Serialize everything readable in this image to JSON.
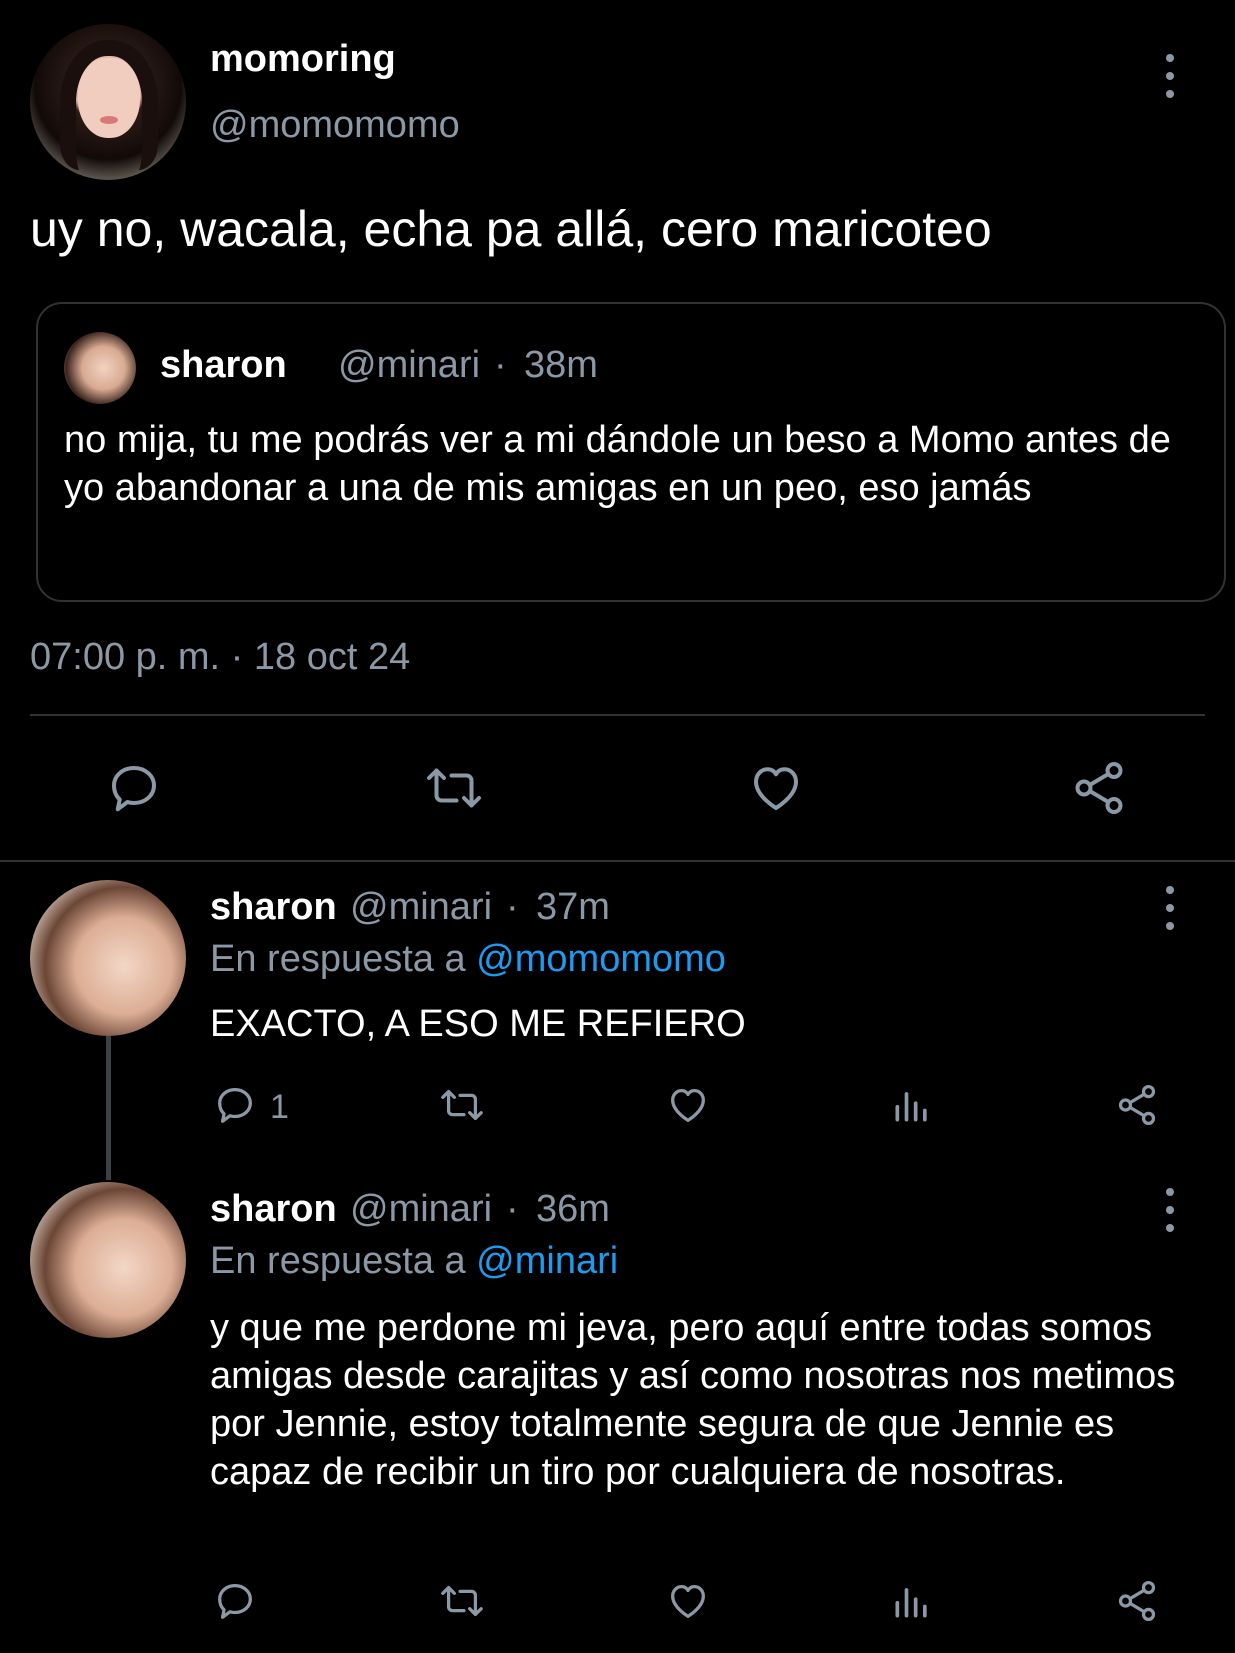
{
  "main_tweet": {
    "author_name": "momoring",
    "author_handle": "@momomomo",
    "text": "uy no, wacala, echa pa allá, cero maricoteo",
    "timestamp": "07:00 p. m. · 18 oct 24",
    "quoted": {
      "author_name": "sharon",
      "author_handle": "@minari",
      "time_sep": "·",
      "time": "38m",
      "text": "no mija, tu me podrás ver a mi dándole un beso a Momo antes de yo abandonar a una de mis amigas en un peo, eso jamás"
    },
    "actions": [
      "reply-icon",
      "retweet-icon",
      "like-icon",
      "share-icon"
    ]
  },
  "replies": [
    {
      "author_name": "sharon",
      "author_handle": "@minari",
      "time_sep": "·",
      "time": "37m",
      "reply_prefix": "En respuesta a",
      "reply_to": "@momomomo",
      "text": "EXACTO, A ESO ME REFIERO",
      "reply_count": "1",
      "actions": [
        "reply-icon",
        "retweet-icon",
        "like-icon",
        "analytics-icon",
        "share-icon"
      ]
    },
    {
      "author_name": "sharon",
      "author_handle": "@minari",
      "time_sep": "·",
      "time": "36m",
      "reply_prefix": "En respuesta a",
      "reply_to": "@minari",
      "text": "y que me perdone mi jeva, pero aquí entre todas somos amigas desde carajitas y así como nosotras nos metimos por Jennie, estoy totalmente segura de que Jennie es capaz de recibir un tiro por cualquiera de nosotras.",
      "actions": [
        "reply-icon",
        "retweet-icon",
        "like-icon",
        "analytics-icon",
        "share-icon"
      ]
    }
  ],
  "colors": {
    "background": "#000000",
    "text": "#ffffff",
    "secondary": "#8b98a5",
    "mention": "#1d9bf0",
    "border": "#2f3336"
  }
}
